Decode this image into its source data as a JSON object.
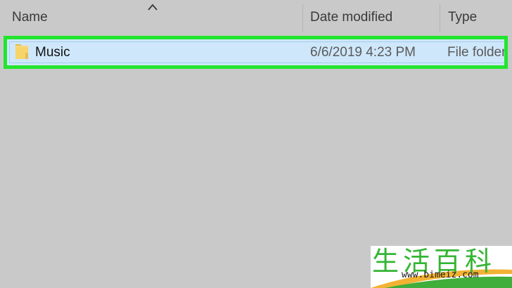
{
  "header": {
    "columns": [
      {
        "label": "Name"
      },
      {
        "label": "Date modified"
      },
      {
        "label": "Type"
      }
    ],
    "sort_icon": "chevron-up-icon"
  },
  "rows": [
    {
      "name": "Music",
      "date_modified": "6/6/2019 4:23 PM",
      "type": "File folder",
      "icon": "folder-icon",
      "selected": true
    }
  ],
  "colors": {
    "background": "#c9c9c9",
    "selection_fill": "#cfe7fa",
    "highlight_border": "#22e52d",
    "folder": "#f7d46a"
  },
  "watermark": {
    "characters": "生活百科",
    "url": "www.bimeiz.com"
  }
}
